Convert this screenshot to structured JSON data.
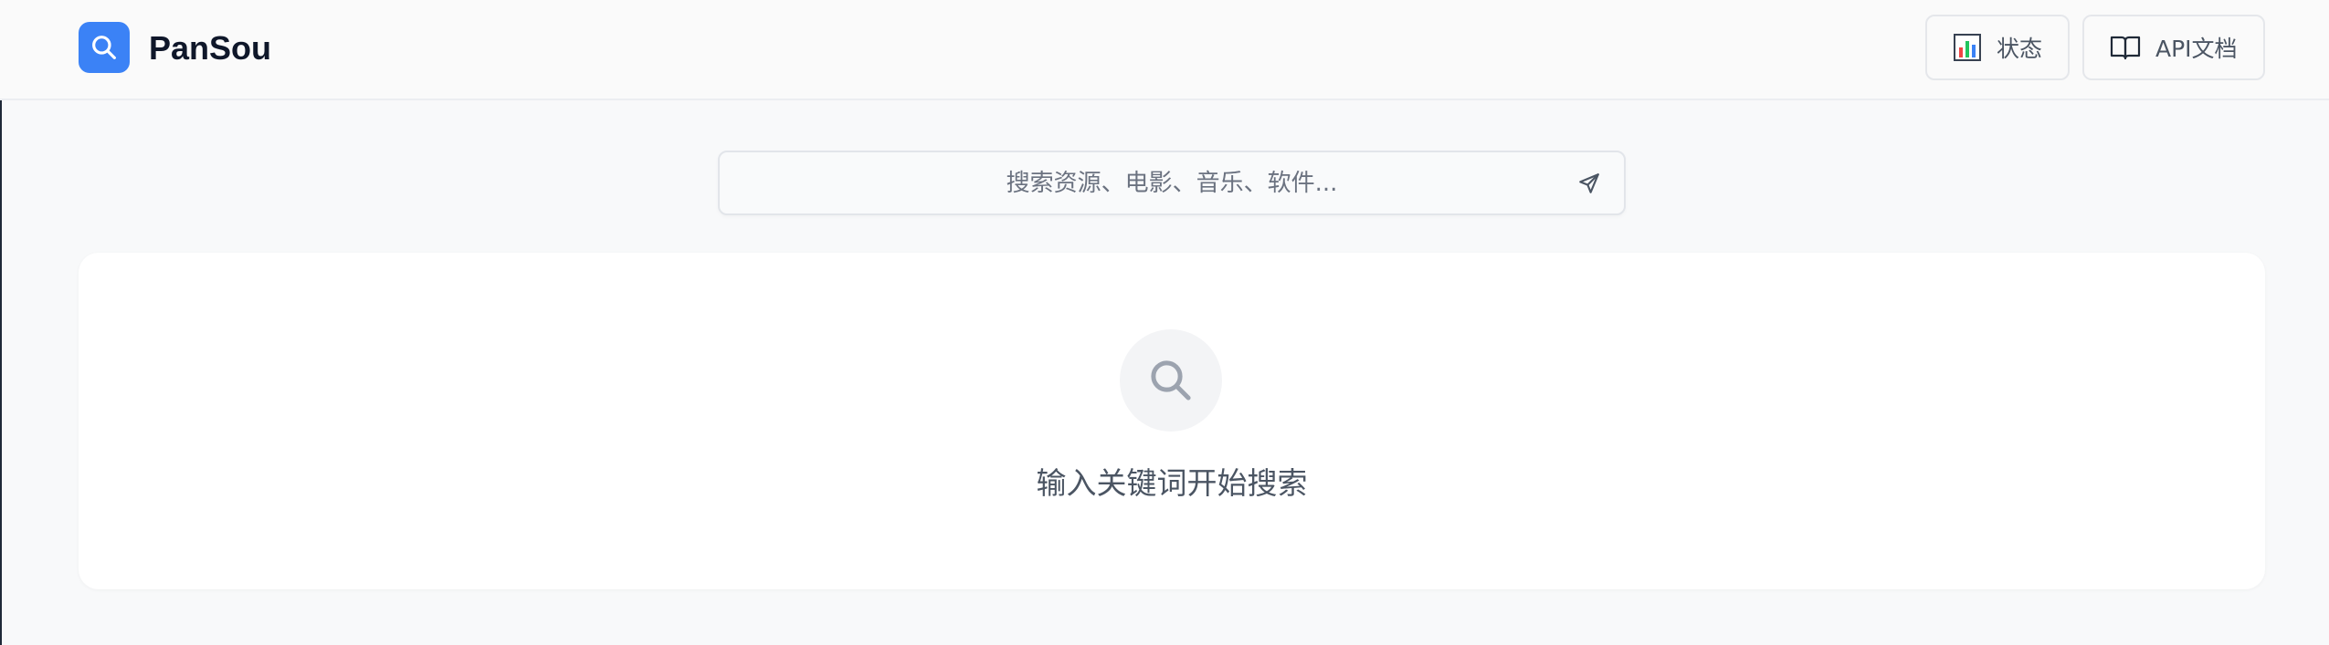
{
  "app": {
    "name": "PanSou",
    "logo_icon": "search-icon",
    "accent_color": "#3b82f6"
  },
  "header": {
    "buttons": [
      {
        "label": "状态",
        "icon": "bar-chart-icon"
      },
      {
        "label": "API文档",
        "icon": "book-icon"
      }
    ]
  },
  "search": {
    "value": "",
    "placeholder": "搜索资源、电影、音乐、软件...",
    "submit_icon": "send-icon"
  },
  "empty_state": {
    "icon": "search-icon",
    "message": "输入关键词开始搜索"
  }
}
